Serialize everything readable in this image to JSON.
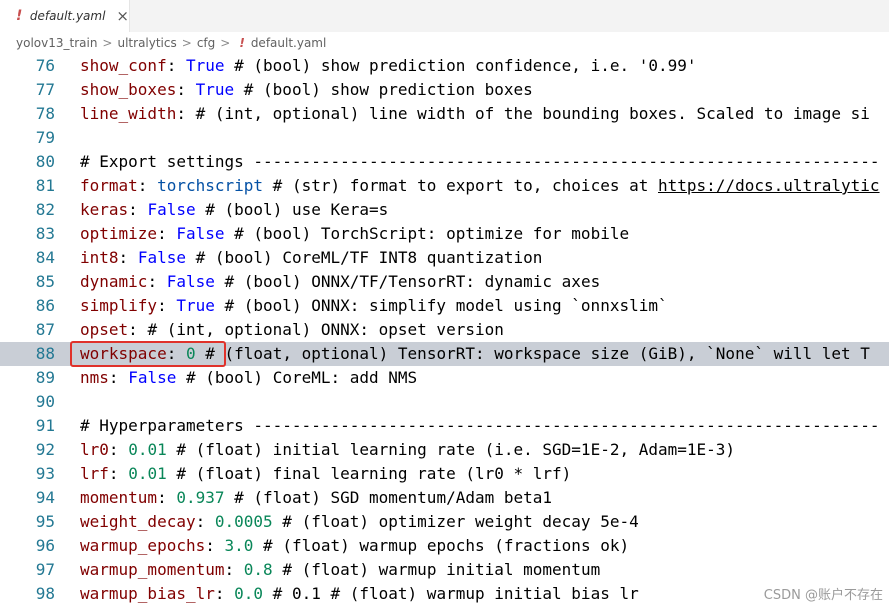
{
  "tab": {
    "icon": "!",
    "title": "default.yaml",
    "close": "×"
  },
  "breadcrumb": {
    "items": [
      "yolov13_train",
      "ultralytics",
      "cfg"
    ],
    "file_icon": "!",
    "file": "default.yaml",
    "separator": ">"
  },
  "lines": [
    {
      "n": "76",
      "key": "show_conf",
      "value": "True",
      "vtype": "bool",
      "comment": " # (bool) show prediction confidence, i.e. '0.99'"
    },
    {
      "n": "77",
      "key": "show_boxes",
      "value": "True",
      "vtype": "bool",
      "comment": " # (bool) show prediction boxes"
    },
    {
      "n": "78",
      "key": "line_width",
      "value": "",
      "vtype": "",
      "comment": " # (int, optional) line width of the bounding boxes. Scaled to image si"
    },
    {
      "n": "79",
      "key": "",
      "value": "",
      "vtype": "",
      "comment": ""
    },
    {
      "n": "80",
      "key": "",
      "value": "",
      "vtype": "",
      "comment": "# Export settings -----------------------------------------------------------------"
    },
    {
      "n": "81",
      "key": "format",
      "value": "torchscript",
      "vtype": "str",
      "comment": " # (str) format to export to, choices at ",
      "link": "https://docs.ultralytic"
    },
    {
      "n": "82",
      "key": "keras",
      "value": "False",
      "vtype": "bool",
      "comment": " # (bool) use Kera=s"
    },
    {
      "n": "83",
      "key": "optimize",
      "value": "False",
      "vtype": "bool",
      "comment": " # (bool) TorchScript: optimize for mobile"
    },
    {
      "n": "84",
      "key": "int8",
      "value": "False",
      "vtype": "bool",
      "comment": " # (bool) CoreML/TF INT8 quantization"
    },
    {
      "n": "85",
      "key": "dynamic",
      "value": "False",
      "vtype": "bool",
      "comment": " # (bool) ONNX/TF/TensorRT: dynamic axes"
    },
    {
      "n": "86",
      "key": "simplify",
      "value": "True",
      "vtype": "bool",
      "comment": " # (bool) ONNX: simplify model using `onnxslim`"
    },
    {
      "n": "87",
      "key": "opset",
      "value": "",
      "vtype": "",
      "comment": " # (int, optional) ONNX: opset version"
    },
    {
      "n": "88",
      "key": "workspace",
      "value": "0",
      "vtype": "num",
      "comment": " # (float, optional) TensorRT: workspace size (GiB), `None` will let T",
      "highlight": true
    },
    {
      "n": "89",
      "key": "nms",
      "value": "False",
      "vtype": "bool",
      "comment": " # (bool) CoreML: add NMS"
    },
    {
      "n": "90",
      "key": "",
      "value": "",
      "vtype": "",
      "comment": ""
    },
    {
      "n": "91",
      "key": "",
      "value": "",
      "vtype": "",
      "comment": "# Hyperparameters -----------------------------------------------------------------"
    },
    {
      "n": "92",
      "key": "lr0",
      "value": "0.01",
      "vtype": "num",
      "comment": " # (float) initial learning rate (i.e. SGD=1E-2, Adam=1E-3)"
    },
    {
      "n": "93",
      "key": "lrf",
      "value": "0.01",
      "vtype": "num",
      "comment": " # (float) final learning rate (lr0 * lrf)"
    },
    {
      "n": "94",
      "key": "momentum",
      "value": "0.937",
      "vtype": "num",
      "comment": " # (float) SGD momentum/Adam beta1"
    },
    {
      "n": "95",
      "key": "weight_decay",
      "value": "0.0005",
      "vtype": "num",
      "comment": " # (float) optimizer weight decay 5e-4"
    },
    {
      "n": "96",
      "key": "warmup_epochs",
      "value": "3.0",
      "vtype": "num",
      "comment": " # (float) warmup epochs (fractions ok)"
    },
    {
      "n": "97",
      "key": "warmup_momentum",
      "value": "0.8",
      "vtype": "num",
      "comment": " # (float) warmup initial momentum"
    },
    {
      "n": "98",
      "key": "warmup_bias_lr",
      "value": "0.0",
      "vtype": "num",
      "comment": " # 0.1 # (float) warmup initial bias lr"
    }
  ],
  "watermark": "CSDN @账户不存在",
  "colors": {
    "key": "#800000",
    "bool": "#0000ff",
    "number": "#098658",
    "string": "#0451a5",
    "line_number": "#237893",
    "highlight": "#c9ced6",
    "annotation_box": "#e0322b"
  }
}
